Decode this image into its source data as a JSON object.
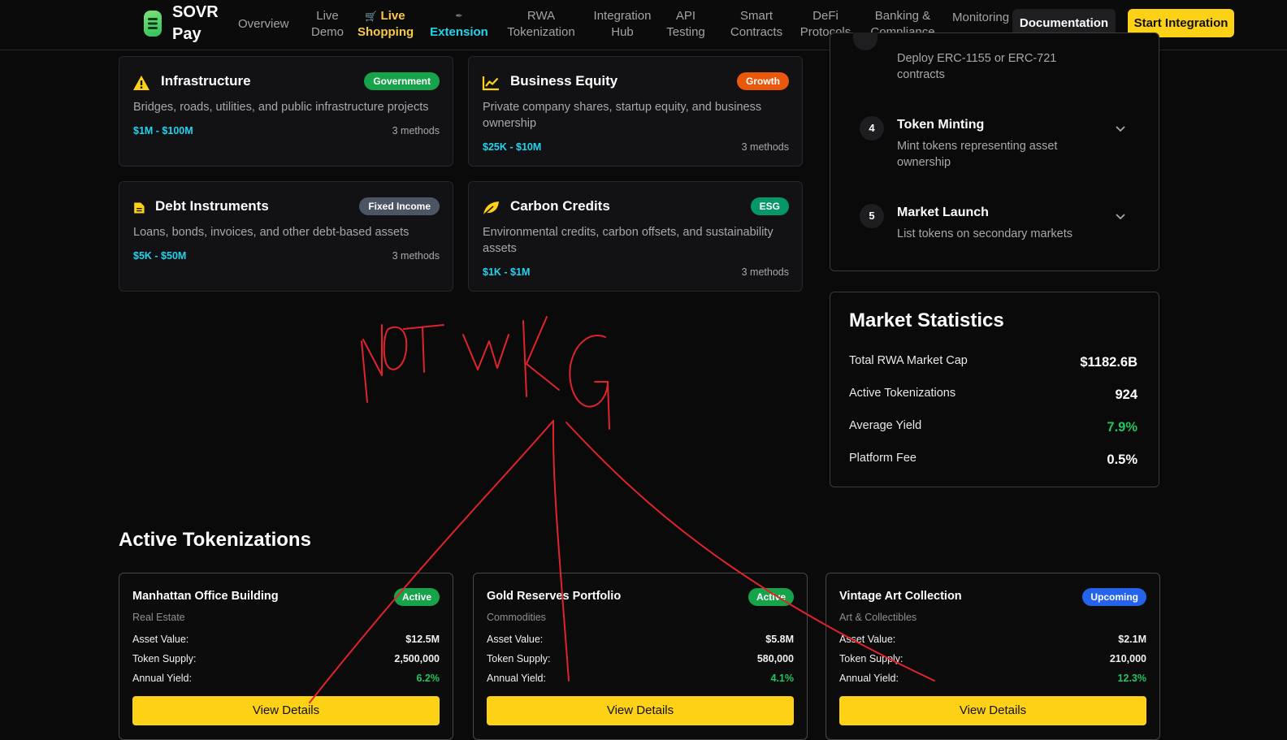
{
  "colors": {
    "accent_yellow": "#fcd116",
    "accent_cyan": "#22d3ee",
    "positive_green": "#22c55e",
    "annotation_red": "#e0242a"
  },
  "nav": {
    "brand": "SOVR Pay",
    "items": [
      {
        "label": "Overview"
      },
      {
        "label": "Live Demo"
      },
      {
        "label": "Live Shopping",
        "icon": "cart-icon"
      },
      {
        "label": "Extension",
        "icon": "wrench-icon"
      },
      {
        "label": "RWA Tokenization"
      },
      {
        "label": "Integration Hub"
      },
      {
        "label": "API Testing"
      },
      {
        "label": "Smart Contracts"
      },
      {
        "label": "DeFi Protocols"
      },
      {
        "label": "Banking & Compliance"
      },
      {
        "label": "Monitoring"
      }
    ],
    "docs_button": "Documentation",
    "start_button": "Start Integration"
  },
  "categories": [
    {
      "title": "Infrastructure",
      "badge": "Government",
      "badge_color": "#16a34a",
      "icon": "warning-icon",
      "desc": "Bridges, roads, utilities, and public infrastructure projects",
      "range": "$1M - $100M",
      "methods": "3 methods"
    },
    {
      "title": "Business Equity",
      "badge": "Growth",
      "badge_color": "#ea580c",
      "icon": "chart-line-icon",
      "desc": "Private company shares, startup equity, and business ownership",
      "range": "$25K - $10M",
      "methods": "3 methods"
    },
    {
      "title": "Debt Instruments",
      "badge": "Fixed Income",
      "badge_color": "#4b5563",
      "icon": "document-icon",
      "desc": "Loans, bonds, invoices, and other debt-based assets",
      "range": "$5K - $50M",
      "methods": "3 methods"
    },
    {
      "title": "Carbon Credits",
      "badge": "ESG",
      "badge_color": "#059669",
      "icon": "leaf-icon",
      "desc": "Environmental credits, carbon offsets, and sustainability assets",
      "range": "$1K - $1M",
      "methods": "3 methods"
    }
  ],
  "steps": {
    "partial_desc": "Deploy ERC-1155 or ERC-721 contracts",
    "items": [
      {
        "num": "4",
        "title": "Token Minting",
        "desc": "Mint tokens representing asset ownership"
      },
      {
        "num": "5",
        "title": "Market Launch",
        "desc": "List tokens on secondary markets"
      }
    ]
  },
  "market_stats": {
    "title": "Market Statistics",
    "rows": [
      {
        "label": "Total RWA Market Cap",
        "value": "$1182.6B"
      },
      {
        "label": "Active Tokenizations",
        "value": "924"
      },
      {
        "label": "Average Yield",
        "value": "7.9%"
      },
      {
        "label": "Platform Fee",
        "value": "0.5%"
      }
    ]
  },
  "active_tokenizations": {
    "title": "Active Tokenizations",
    "cards": [
      {
        "name": "Manhattan Office Building",
        "category": "Real Estate",
        "status": "Active",
        "status_color": "#16a34a",
        "asset_value_label": "Asset Value:",
        "asset_value": "$12.5M",
        "token_supply_label": "Token Supply:",
        "token_supply": "2,500,000",
        "annual_yield_label": "Annual Yield:",
        "annual_yield": "6.2%",
        "button": "View Details"
      },
      {
        "name": "Gold Reserves Portfolio",
        "category": "Commodities",
        "status": "Active",
        "status_color": "#16a34a",
        "asset_value_label": "Asset Value:",
        "asset_value": "$5.8M",
        "token_supply_label": "Token Supply:",
        "token_supply": "580,000",
        "annual_yield_label": "Annual Yield:",
        "annual_yield": "4.1%",
        "button": "View Details"
      },
      {
        "name": "Vintage Art Collection",
        "category": "Art & Collectibles",
        "status": "Upcoming",
        "status_color": "#2563eb",
        "asset_value_label": "Asset Value:",
        "asset_value": "$2.1M",
        "token_supply_label": "Token Supply:",
        "token_supply": "210,000",
        "annual_yield_label": "Annual Yield:",
        "annual_yield": "12.3%",
        "button": "View Details"
      }
    ]
  },
  "annotation": {
    "text": "NOT WKG"
  }
}
